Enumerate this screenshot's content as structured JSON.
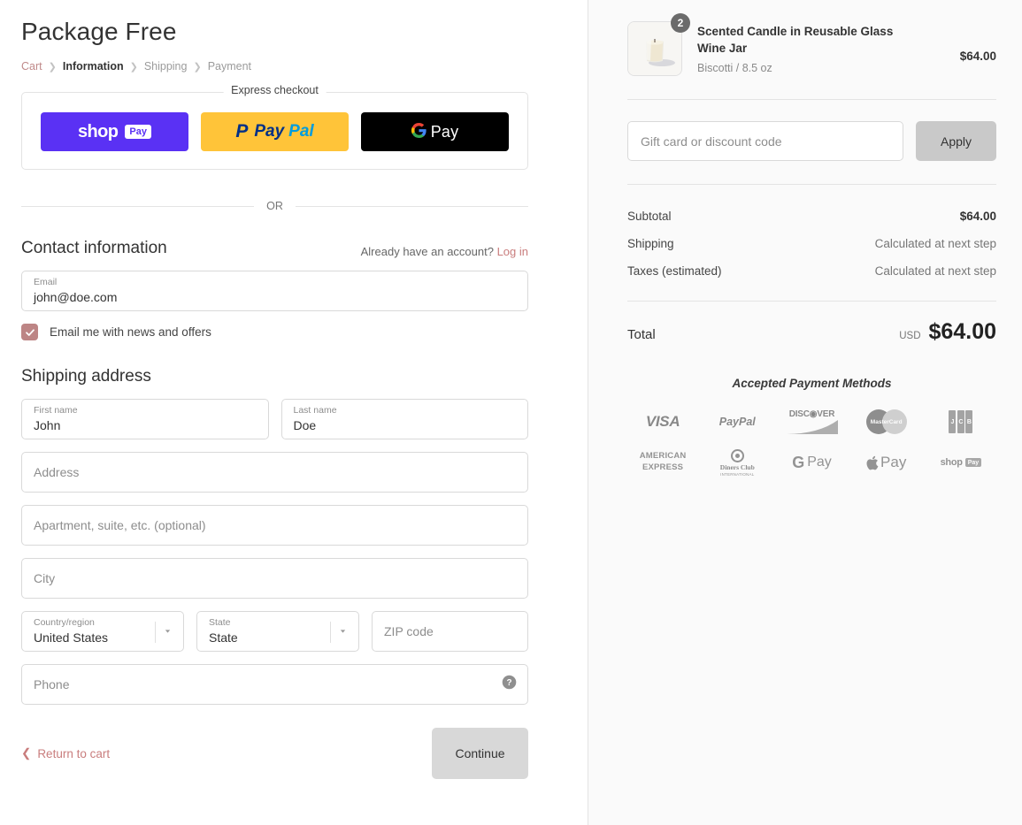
{
  "shop": {
    "title": "Package Free"
  },
  "breadcrumb": [
    {
      "label": "Cart",
      "state": "link"
    },
    {
      "label": "Information",
      "state": "current"
    },
    {
      "label": "Shipping",
      "state": "upcoming"
    },
    {
      "label": "Payment",
      "state": "upcoming"
    }
  ],
  "express": {
    "legend": "Express checkout",
    "buttons": [
      {
        "name": "shop-pay",
        "word": "shop",
        "badge": "Pay"
      },
      {
        "name": "paypal",
        "pay": "Pay",
        "pal": "Pal"
      },
      {
        "name": "google-pay",
        "g": "G",
        "pay": "Pay"
      }
    ]
  },
  "divider": {
    "or": "OR"
  },
  "contact": {
    "title": "Contact information",
    "account_prompt": "Already have an account?",
    "login_label": "Log in",
    "email": {
      "label": "Email",
      "value": "john@doe.com"
    },
    "newsletter_label": "Email me with news and offers",
    "newsletter_checked": true
  },
  "shipping": {
    "title": "Shipping address",
    "first_name": {
      "label": "First name",
      "value": "John"
    },
    "last_name": {
      "label": "Last name",
      "value": "Doe"
    },
    "address": {
      "placeholder": "Address"
    },
    "apartment": {
      "placeholder": "Apartment, suite, etc. (optional)"
    },
    "city": {
      "placeholder": "City"
    },
    "country": {
      "label": "Country/region",
      "value": "United States"
    },
    "state": {
      "label": "State",
      "value": "State"
    },
    "zip": {
      "placeholder": "ZIP code"
    },
    "phone": {
      "placeholder": "Phone"
    }
  },
  "footer": {
    "return_label": "Return to cart",
    "continue_label": "Continue"
  },
  "summary": {
    "item": {
      "title": "Scented Candle in Reusable Glass Wine Jar",
      "variant": "Biscotti / 8.5 oz",
      "quantity": "2",
      "price": "$64.00"
    },
    "discount": {
      "placeholder": "Gift card or discount code",
      "apply_label": "Apply"
    },
    "rows": [
      {
        "label": "Subtotal",
        "value": "$64.00",
        "muted": false
      },
      {
        "label": "Shipping",
        "value": "Calculated at next step",
        "muted": true
      },
      {
        "label": "Taxes (estimated)",
        "value": "Calculated at next step",
        "muted": true
      }
    ],
    "total": {
      "label": "Total",
      "currency": "USD",
      "value": "$64.00"
    },
    "payment_methods_title": "Accepted Payment Methods",
    "payment_methods": [
      {
        "name": "visa",
        "text": "VISA"
      },
      {
        "name": "paypal",
        "text": "PayPal"
      },
      {
        "name": "discover",
        "text": "DISC◉VER"
      },
      {
        "name": "mastercard",
        "text": "MasterCard"
      },
      {
        "name": "jcb",
        "text": "JCB"
      },
      {
        "name": "american-express",
        "line1": "AMERICAN",
        "line2": "EXPRESS"
      },
      {
        "name": "diners-club",
        "line1": "Diners Club",
        "line2": "INTERNATIONAL"
      },
      {
        "name": "google-pay",
        "g": "G",
        "text": "Pay"
      },
      {
        "name": "apple-pay",
        "text": "Pay"
      },
      {
        "name": "shop-pay",
        "word": "shop",
        "badge": "Pay"
      }
    ]
  },
  "colors": {
    "accent_rose": "#c97d7d",
    "shop_pay_purple": "#5a31f4",
    "paypal_yellow": "#ffc439",
    "checkbox": "#bd8585"
  }
}
